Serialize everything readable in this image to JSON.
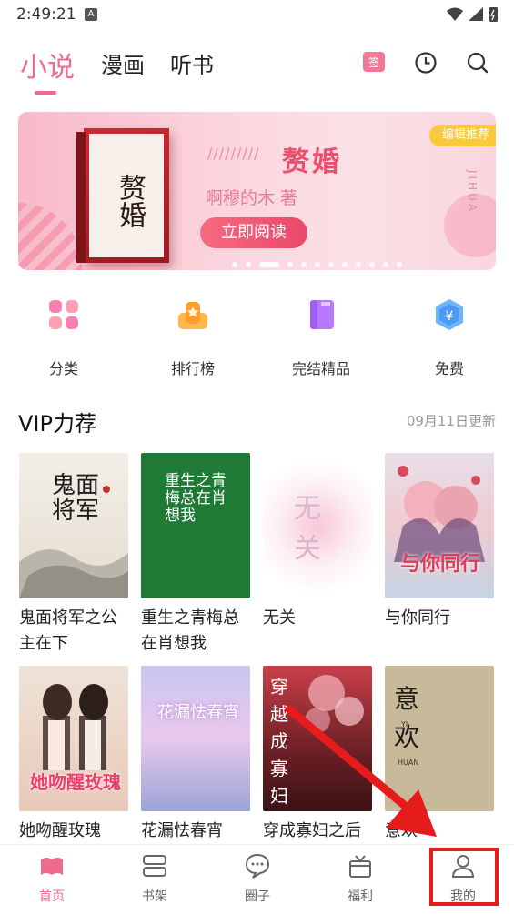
{
  "status_bar": {
    "time": "2:49:21",
    "notif": "A"
  },
  "tabs": [
    {
      "label": "小说"
    },
    {
      "label": "漫画"
    },
    {
      "label": "听书"
    }
  ],
  "header": {
    "calendar_label": "签"
  },
  "banner": {
    "cover_title": "赘婚",
    "title": "赘婚",
    "slashes": "/////////",
    "author": "啊穆的木  著",
    "button": "立即阅读",
    "tag": "编辑推荐",
    "side_text": "JIHUA"
  },
  "categories": [
    {
      "label": "分类",
      "icon": "grid-icon"
    },
    {
      "label": "排行榜",
      "icon": "ranking-icon"
    },
    {
      "label": "完结精品",
      "icon": "book-icon"
    },
    {
      "label": "免费",
      "icon": "free-icon"
    }
  ],
  "section": {
    "title": "VIP力荐",
    "date": "09月11日更新"
  },
  "books": [
    {
      "name": "鬼面将军之公主在下",
      "cover_text": "鬼面将军"
    },
    {
      "name": "重生之青梅总在肖想我",
      "cover_text": "重生之青梅总在肖想我"
    },
    {
      "name": "无关",
      "cover_text": "无关"
    },
    {
      "name": "与你同行",
      "cover_text": "与你同行"
    },
    {
      "name": "她吻醒玫瑰",
      "cover_text": "她吻醒玫瑰"
    },
    {
      "name": "花漏怯春宵",
      "cover_text": "花漏怯春宵"
    },
    {
      "name": "穿成寡妇之后",
      "cover_text": "穿越成寡妇之后"
    },
    {
      "name": "意欢",
      "cover_text": "意欢",
      "cover_sub": "YI",
      "cover_sub2": "HUAN"
    }
  ],
  "nav": [
    {
      "label": "首页",
      "icon": "home-icon",
      "active": true
    },
    {
      "label": "书架",
      "icon": "bookshelf-icon"
    },
    {
      "label": "圈子",
      "icon": "chat-icon"
    },
    {
      "label": "福利",
      "icon": "gift-icon"
    },
    {
      "label": "我的",
      "icon": "user-icon"
    }
  ],
  "colors": {
    "accent": "#f0698e",
    "highlight": "#e61b1b"
  }
}
